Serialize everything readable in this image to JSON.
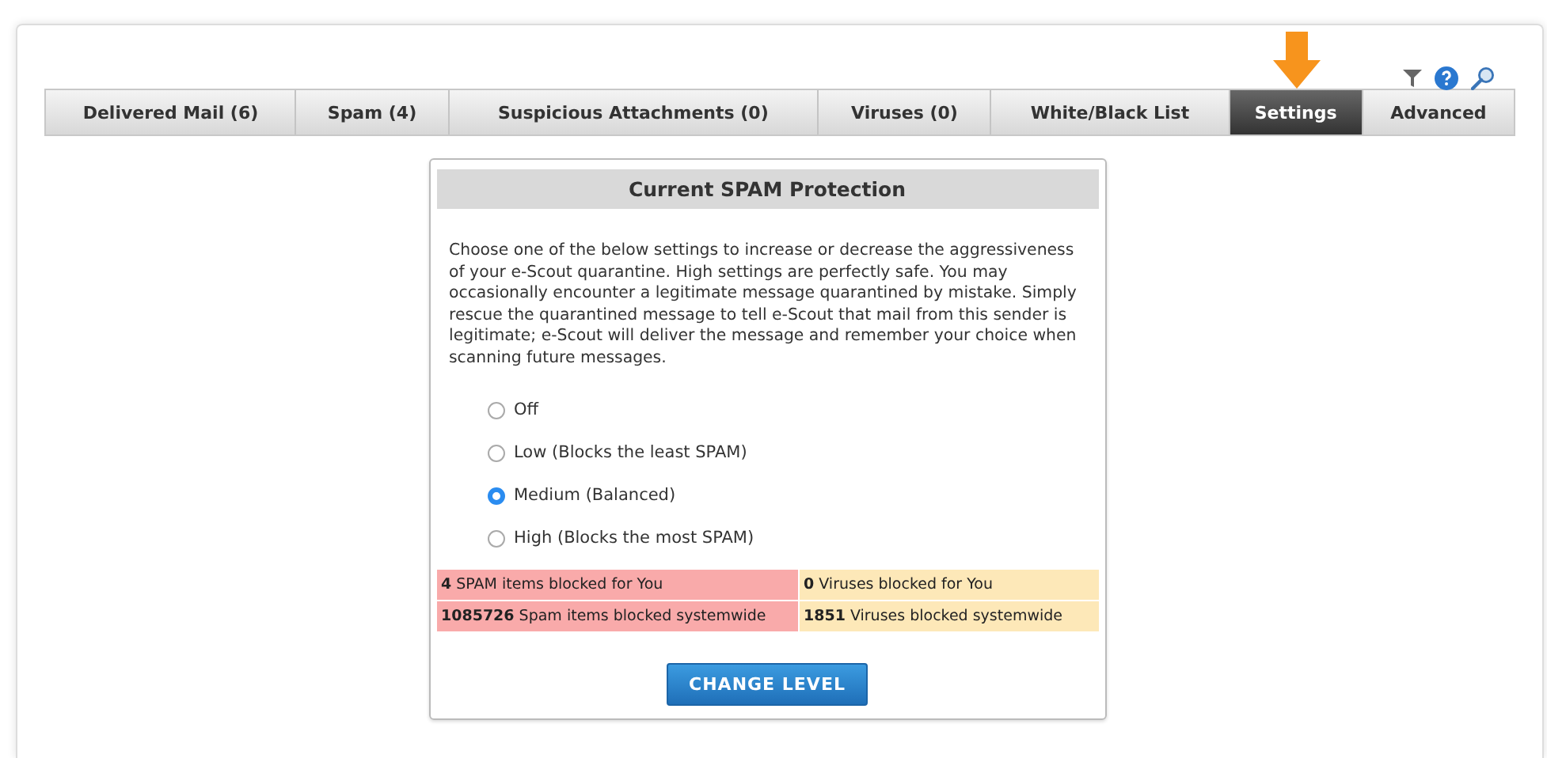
{
  "tabs": [
    {
      "label": "Delivered Mail (6)",
      "selected": false
    },
    {
      "label": "Spam (4)",
      "selected": false
    },
    {
      "label": "Suspicious Attachments (0)",
      "selected": false
    },
    {
      "label": "Viruses (0)",
      "selected": false
    },
    {
      "label": "White/Black List",
      "selected": false
    },
    {
      "label": "Settings",
      "selected": true
    },
    {
      "label": "Advanced",
      "selected": false
    }
  ],
  "panel": {
    "title": "Current SPAM Protection",
    "description": "Choose one of the below settings to increase or decrease the aggressiveness of your e-Scout quarantine. High settings are perfectly safe. You may occasionally encounter a legitimate message quarantined by mistake. Simply rescue the quarantined message to tell e-Scout that mail from this sender is legitimate; e-Scout will deliver the message and remember your choice when scanning future messages.",
    "levels": [
      {
        "label": "Off",
        "selected": false
      },
      {
        "label": "Low (Blocks the least SPAM)",
        "selected": false
      },
      {
        "label": "Medium (Balanced)",
        "selected": true
      },
      {
        "label": "High (Blocks the most SPAM)",
        "selected": false
      }
    ],
    "stats": [
      {
        "text": "**4** SPAM items blocked for You",
        "color": "#f9aaaa"
      },
      {
        "text": "**0** Viruses blocked for You",
        "color": "#fde8b8"
      },
      {
        "text": "**1085726** Spam items blocked systemwide",
        "color": "#f9aaaa"
      },
      {
        "text": "**1851** Viruses blocked systemwide",
        "color": "#fde8b8"
      }
    ],
    "button": "CHANGE LEVEL"
  }
}
